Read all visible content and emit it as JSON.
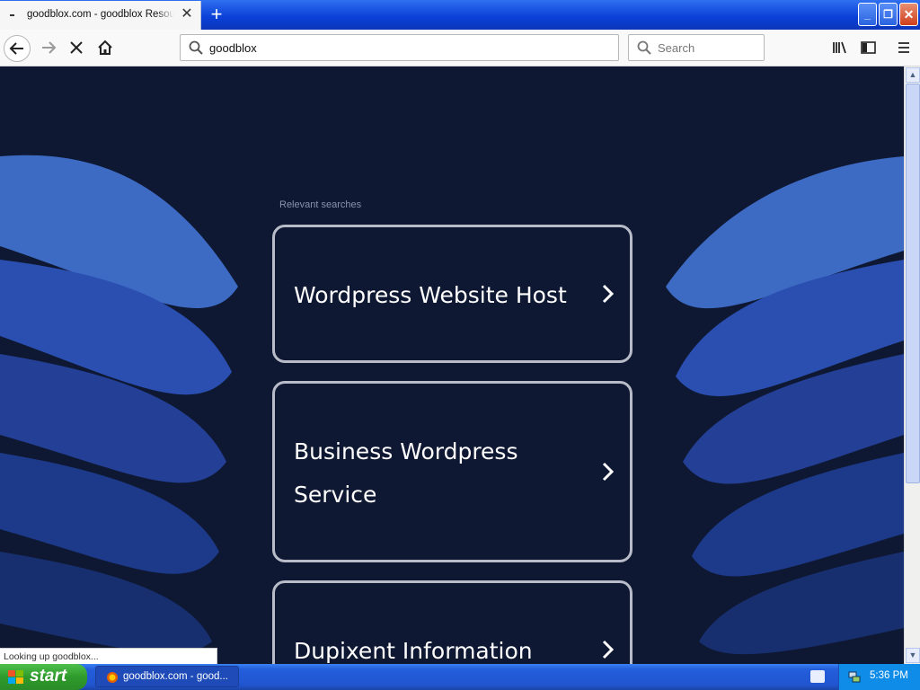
{
  "browser": {
    "tab_title": "goodblox.com - goodblox Resources",
    "new_tab_icon": "plus-icon",
    "url": "goodblox",
    "search_placeholder": "Search"
  },
  "window_controls": {
    "minimize": "_",
    "maximize": "❐",
    "close": "✕"
  },
  "content": {
    "relevant_label": "Relevant searches",
    "results": [
      {
        "label": "Wordpress Website Host"
      },
      {
        "label": "Business Wordpress Service"
      },
      {
        "label": "Dupixent Information"
      }
    ],
    "background_color": "#0f1833",
    "wave_colors": [
      "#3d6bc4",
      "#2a4fb0",
      "#1d3a8a",
      "#172f6e"
    ]
  },
  "status": {
    "text": "Looking up goodblox..."
  },
  "taskbar": {
    "start_label": "start",
    "task_item_label": "goodblox.com - good...",
    "clock": "5:36 PM"
  }
}
